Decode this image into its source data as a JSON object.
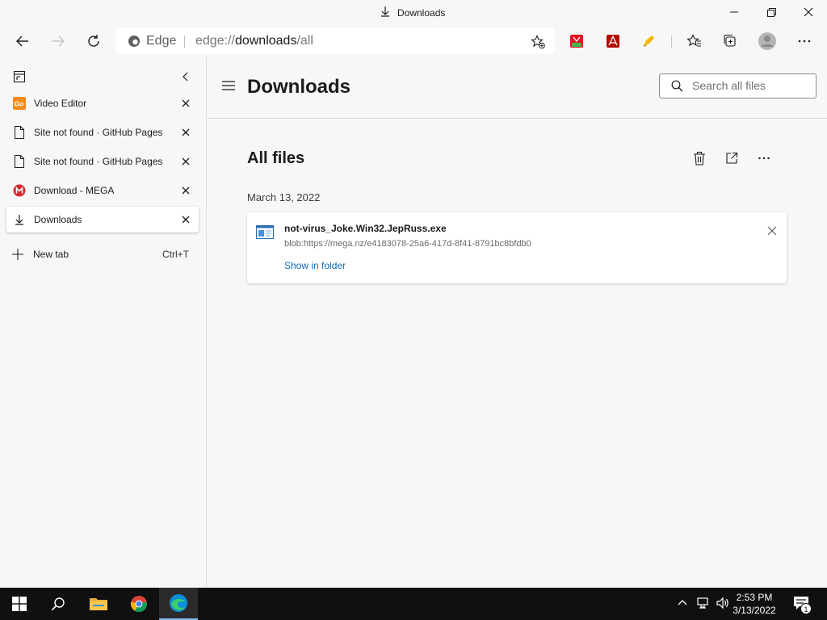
{
  "window": {
    "title": "Downloads"
  },
  "address": {
    "brand": "Edge",
    "url_scheme": "edge://",
    "url_host": "downloads",
    "url_path": "/all"
  },
  "sidebar": {
    "tabs": [
      {
        "label": "Video Editor",
        "icon": "goplay-icon"
      },
      {
        "label": "Site not found · GitHub Pages",
        "icon": "page-icon"
      },
      {
        "label": "Site not found · GitHub Pages",
        "icon": "page-icon"
      },
      {
        "label": "Download - MEGA",
        "icon": "mega-icon"
      },
      {
        "label": "Downloads",
        "icon": "download-icon",
        "active": true
      }
    ],
    "new_tab": {
      "label": "New tab",
      "shortcut": "Ctrl+T"
    }
  },
  "downloads": {
    "title": "Downloads",
    "search_placeholder": "Search all files",
    "section_title": "All files",
    "date": "March 13, 2022",
    "items": [
      {
        "filename": "not-virus_Joke.Win32.JepRuss.exe",
        "url": "blob:https://mega.nz/e4183078-25a6-417d-8f41-8791bc8bfdb0",
        "action": "Show in folder"
      }
    ]
  },
  "taskbar": {
    "time": "2:53 PM",
    "date": "3/13/2022",
    "notification_count": "1"
  },
  "colors": {
    "accent": "#0f6cbd",
    "taskbar": "#101010",
    "background": "#f7f7f7"
  }
}
